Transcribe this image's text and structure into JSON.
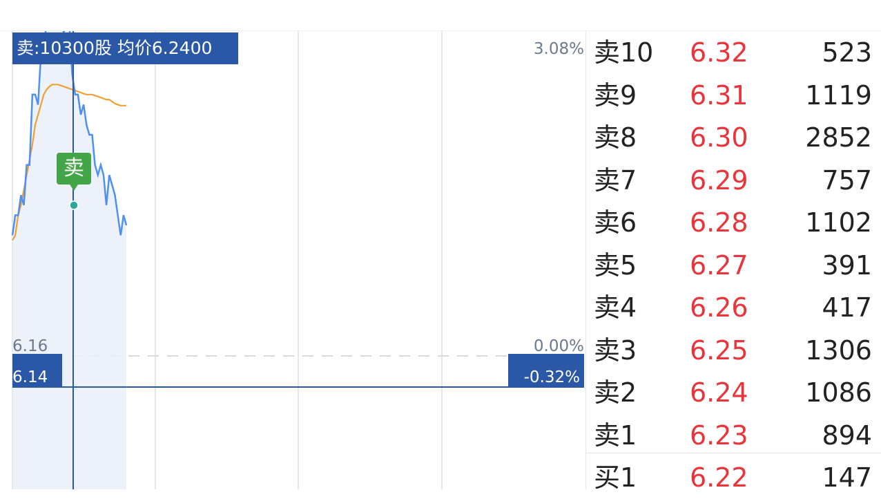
{
  "colors": {
    "accent": "#2b58a6",
    "price_up": "#e8343a",
    "line_price": "#4f8ff0",
    "line_avg": "#f0a030",
    "sell_marker": "#43a547",
    "grid": "#e2e6ee",
    "muted_text": "#6b7a8f"
  },
  "chart": {
    "info": "卖:10300股 均价6.2400",
    "pct_top": "3.08%",
    "pct_zero": "0.00%",
    "pct_low": "-0.32%",
    "price_ref": "6.16",
    "price_low": "6.14",
    "marker": "卖"
  },
  "chart_data": {
    "type": "line",
    "y_percent_range": [
      -0.32,
      3.08
    ],
    "series": [
      {
        "values": [
          1.2,
          1.4,
          1.4,
          1.6,
          1.5,
          1.9,
          1.9,
          2.6,
          2.6,
          2.5,
          3.0,
          3.1,
          3.3,
          3.5,
          3.6,
          3.4,
          3.4,
          3.5,
          3.2,
          3.4,
          3.3,
          2.8,
          2.6,
          2.6,
          2.4,
          2.5,
          2.3,
          2.2,
          2.2,
          1.9,
          1.8,
          1.9,
          1.8,
          1.5,
          1.8,
          1.7,
          1.6,
          1.4,
          1.2,
          1.4,
          1.3
        ]
      },
      {
        "values": [
          1.15,
          1.2,
          1.4,
          1.5,
          1.65,
          1.8,
          1.95,
          2.1,
          2.3,
          2.4,
          2.5,
          2.6,
          2.65,
          2.68,
          2.7,
          2.7,
          2.7,
          2.69,
          2.68,
          2.67,
          2.66,
          2.65,
          2.64,
          2.63,
          2.62,
          2.61,
          2.6,
          2.6,
          2.6,
          2.59,
          2.58,
          2.57,
          2.56,
          2.55,
          2.55,
          2.53,
          2.51,
          2.5,
          2.49,
          2.49,
          2.49
        ]
      }
    ]
  },
  "orderbook": {
    "rows": [
      {
        "label": "卖10",
        "price": "6.32",
        "vol": "523"
      },
      {
        "label": "卖9",
        "price": "6.31",
        "vol": "1119"
      },
      {
        "label": "卖8",
        "price": "6.30",
        "vol": "2852"
      },
      {
        "label": "卖7",
        "price": "6.29",
        "vol": "757"
      },
      {
        "label": "卖6",
        "price": "6.28",
        "vol": "1102"
      },
      {
        "label": "卖5",
        "price": "6.27",
        "vol": "391"
      },
      {
        "label": "卖4",
        "price": "6.26",
        "vol": "417"
      },
      {
        "label": "卖3",
        "price": "6.25",
        "vol": "1306"
      },
      {
        "label": "卖2",
        "price": "6.24",
        "vol": "1086"
      },
      {
        "label": "卖1",
        "price": "6.23",
        "vol": "894"
      },
      {
        "label": "买1",
        "price": "6.22",
        "vol": "147"
      }
    ]
  }
}
